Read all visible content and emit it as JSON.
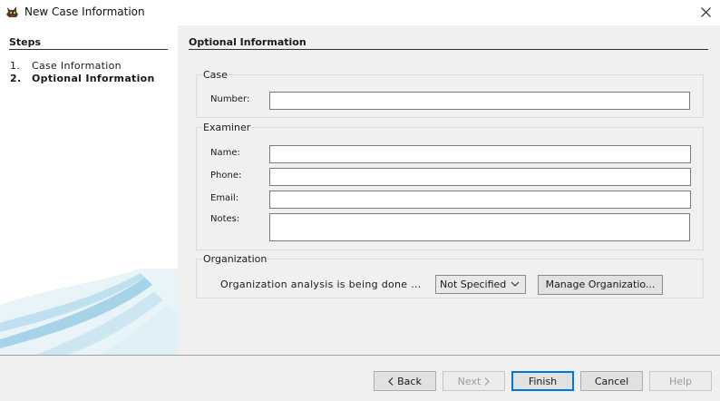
{
  "window": {
    "title": "New Case Information",
    "icon": "dog-icon",
    "close_icon": "close-icon"
  },
  "steps": {
    "header": "Steps",
    "items": [
      {
        "num": "1.",
        "label": "Case Information"
      },
      {
        "num": "2.",
        "label": "Optional Information"
      }
    ]
  },
  "main": {
    "header": "Optional Information",
    "case": {
      "title": "Case",
      "number_label": "Number:",
      "number_value": ""
    },
    "examiner": {
      "title": "Examiner",
      "name_label": "Name:",
      "name_value": "",
      "phone_label": "Phone:",
      "phone_value": "",
      "email_label": "Email:",
      "email_value": "",
      "notes_label": "Notes:",
      "notes_value": ""
    },
    "organization": {
      "title": "Organization",
      "text": "Organization analysis is being done ...",
      "selected": "Not Specified",
      "manage_label": "Manage Organizatio..."
    }
  },
  "buttons": {
    "back": "Back",
    "next": "Next",
    "finish": "Finish",
    "cancel": "Cancel",
    "help": "Help"
  },
  "colors": {
    "panel_bg": "#f0f0f0",
    "focus_accent": "#0078d7",
    "swoosh": "#6fb7d6"
  }
}
